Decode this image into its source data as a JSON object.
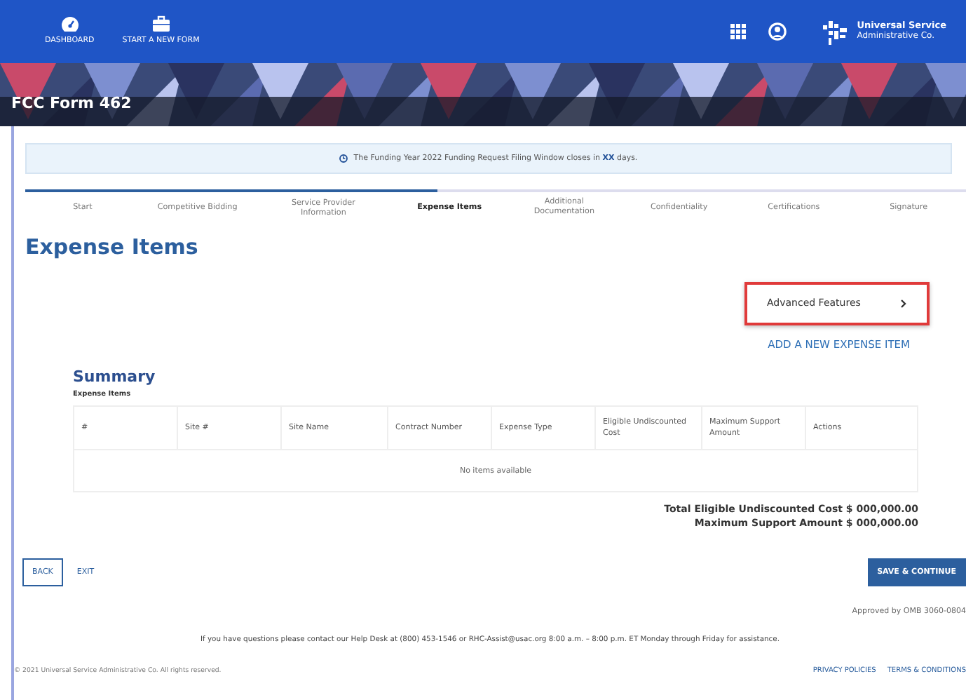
{
  "header": {
    "nav": [
      {
        "label": "DASHBOARD",
        "kind": "dashboard"
      },
      {
        "label": "START A NEW FORM",
        "kind": "briefcase"
      }
    ],
    "org_line_1": "Universal Service",
    "org_line_2": "Administrative Co."
  },
  "banner": {
    "title": "FCC Form 462"
  },
  "alert": {
    "before": "The Funding Year 2022 Funding Request Filing Window closes in **XX** days."
  },
  "steps": [
    {
      "label": "Start",
      "selected": false
    },
    {
      "label": "Competitive Bidding",
      "selected": false
    },
    {
      "label": "Service Provider Information",
      "selected": false
    },
    {
      "label": "Expense Items",
      "selected": true
    },
    {
      "label": "Additional Documentation",
      "selected": false
    },
    {
      "label": "Confidentiality",
      "selected": false
    },
    {
      "label": "Certifications",
      "selected": false
    },
    {
      "label": "Signature",
      "selected": false
    }
  ],
  "heading": "Expense Items",
  "advanced_button": "Advanced Features",
  "add_link": "ADD A NEW EXPENSE ITEM",
  "summary": {
    "title": "Summary",
    "subtitle": "Expense Items",
    "columns": [
      "#",
      "Site #",
      "Site Name",
      "Contract Number",
      "Expense Type",
      "Eligible Undiscounted Cost",
      "Maximum Support Amount",
      "Actions"
    ],
    "empty": "No items available",
    "total_cost": "Total Eligible Undiscounted Cost $ 000,000.00",
    "max_support": "Maximum Support Amount $ 000,000.00"
  },
  "buttons": {
    "back": "BACK",
    "exit": "EXIT",
    "save": "SAVE & CONTINUE"
  },
  "approved": "Approved by OMB 3060-0804",
  "help": "If you have questions please contact our Help Desk at (800) 453-1546 or RHC-Assist@usac.org 8:00 a.m. – 8:00 p.m. ET Monday through Friday for assistance.",
  "footer": {
    "copyright": "© 2021 Universal Service Administrative Co. All rights reserved.",
    "links": [
      "PRIVACY POLICIES",
      "TERMS & CONDITIONS"
    ]
  }
}
